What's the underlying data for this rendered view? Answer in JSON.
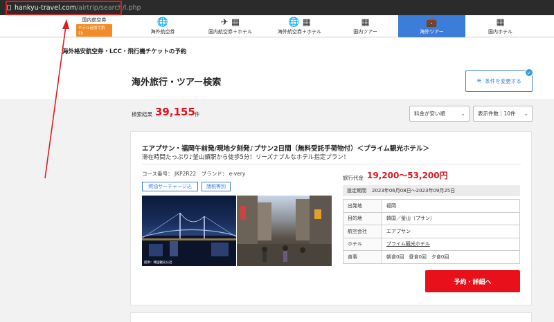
{
  "browser": {
    "url_domain": "hankyu-travel.com",
    "url_path": "/airtrip/search/l.php"
  },
  "nav": {
    "first_label": "国内航空券",
    "first_badge": "ホテル追加で割引!",
    "items": [
      {
        "label": "海外航空券",
        "icon": "globe-plane-icon"
      },
      {
        "label": "国内航空券＋ホテル",
        "icon": "plane-hotel-icon"
      },
      {
        "label": "海外航空券＋ホテル",
        "icon": "globe-hotel-icon"
      },
      {
        "label": "国内ツアー",
        "icon": "building-icon"
      },
      {
        "label": "海外ツアー",
        "icon": "suitcase-icon"
      },
      {
        "label": "国内ホテル",
        "icon": "hotel-icon"
      }
    ],
    "active_color": "#3b7dd8"
  },
  "page": {
    "subtitle": "海外格安航空券・LCC・飛行機チケットの予約",
    "title": "海外旅行・ツアー検索",
    "change_button": "条件を変更する"
  },
  "results": {
    "label": "検索結果",
    "count": "39,155",
    "unit": "件",
    "sort_select": "料金が安い順",
    "per_page_select": "表示件数｜10件"
  },
  "tour": {
    "title": "エアプサン・福岡午前発/現地夕刻発♪プサン2日間（無料受託手荷物付）＜プライム観光ホテル＞",
    "description": "滞在時間たっぷり♪釜山鎮駅から徒歩5分！リーズナブルなホテル指定プラン！",
    "course": "コース番号： JKP2R22　ブランド： e-very",
    "tags": [
      "燃油サーチャージ込",
      "諸税等別"
    ],
    "photo_caption": "提供：韓国観光公社",
    "price_label": "旅行代金",
    "price": "19,200〜53,200円",
    "period_label": "設定期間",
    "period": "2023年06月08日〜2023年09月25日",
    "info": [
      {
        "key": "出発地",
        "value": "福岡"
      },
      {
        "key": "目的地",
        "value": "韓国／釜山（プサン）"
      },
      {
        "key": "航空会社",
        "value": "エアプサン"
      },
      {
        "key": "ホテル",
        "value": "プライム観光ホテル"
      },
      {
        "key": "食事",
        "value": "朝食0回　昼食0回　夕食0回"
      }
    ],
    "book_button": "予約・詳細へ",
    "accent_color": "#e0141e"
  }
}
